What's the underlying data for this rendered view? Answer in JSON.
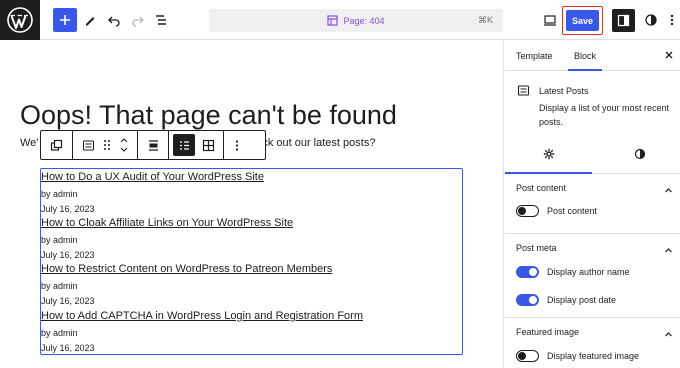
{
  "topbar": {
    "command_center_label": "Page: 404",
    "shortcut": "⌘K",
    "save_label": "Save"
  },
  "canvas": {
    "heading": "Oops! That page can't be found",
    "subtext_start": "We'",
    "subtext_fragment": "ki",
    "subtext_end": "ot check out our latest posts?",
    "posts": [
      {
        "title": "How to Do a UX Audit of Your WordPress Site",
        "author": "by admin",
        "date": "July 16, 2023"
      },
      {
        "title": "How to Cloak Affiliate Links on Your WordPress Site",
        "author": "by admin",
        "date": "July 16, 2023"
      },
      {
        "title": "How to Restrict Content on WordPress to Patreon Members",
        "author": "by admin",
        "date": "July 16, 2023"
      },
      {
        "title": "How to Add CAPTCHA in WordPress Login and Registration Form",
        "author": "by admin",
        "date": "July 16, 2023"
      }
    ]
  },
  "sidebar": {
    "tabs": [
      "Template",
      "Block"
    ],
    "active_tab": "Block",
    "block_card": {
      "title": "Latest Posts",
      "description": "Display a list of your most recent posts."
    },
    "panels": {
      "post_content": {
        "title": "Post content",
        "toggle_label": "Post content",
        "toggle_on": false
      },
      "post_meta": {
        "title": "Post meta",
        "toggles": [
          {
            "label": "Display author name",
            "on": true
          },
          {
            "label": "Display post date",
            "on": true
          }
        ]
      },
      "featured_image": {
        "title": "Featured image",
        "toggle_label": "Display featured image",
        "toggle_on": false
      }
    }
  },
  "colors": {
    "accent": "#3858e9",
    "highlight_outline": "#e0321c",
    "template_purple": "#8a4de2"
  }
}
